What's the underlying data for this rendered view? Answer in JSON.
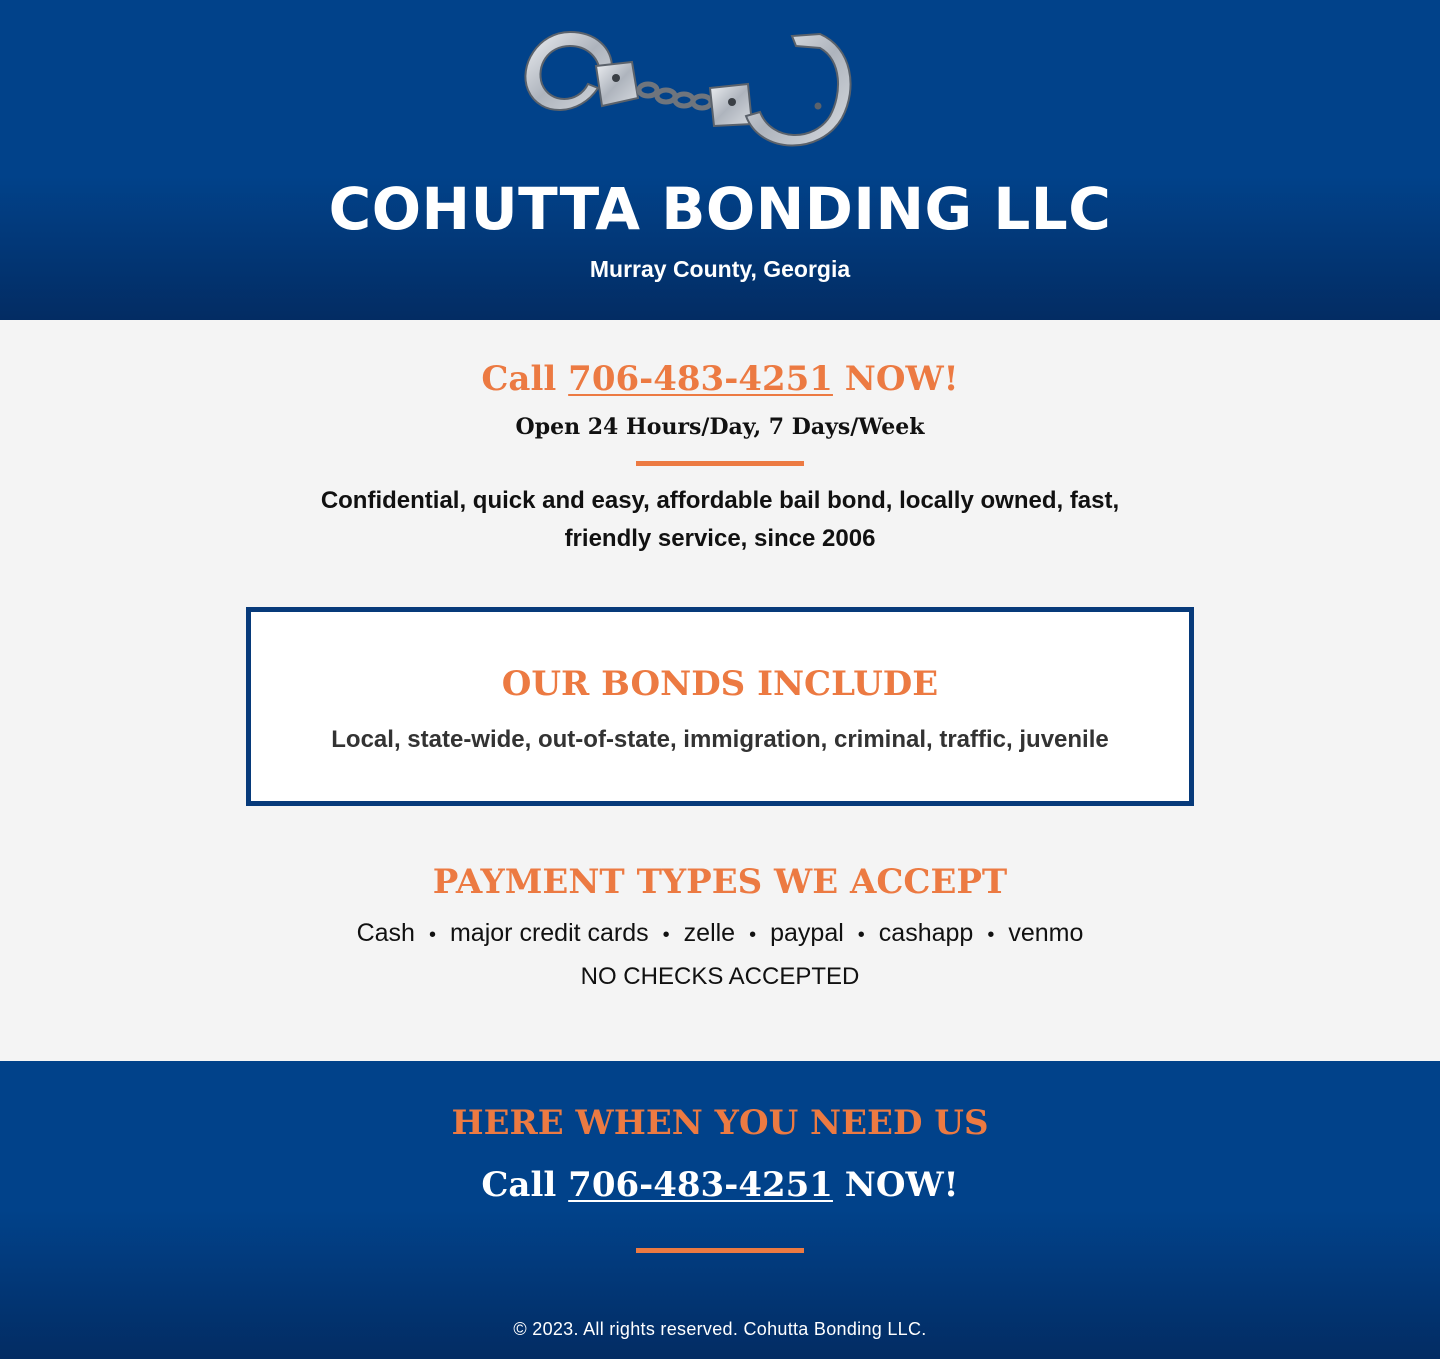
{
  "header": {
    "logo_icon": "handcuffs-icon",
    "title": "COHUTTA BONDING LLC",
    "subtitle": "Murray County, Georgia"
  },
  "main": {
    "call_prefix": "Call",
    "phone": "706-483-4251",
    "call_suffix": "NOW!",
    "hours": "Open 24 Hours/Day, 7 Days/Week",
    "tagline": "Confidential, quick and easy, affordable bail bond, locally owned, fast, friendly service, since 2006"
  },
  "bonds": {
    "title": "OUR BONDS INCLUDE",
    "list": "Local, state-wide, out-of-state, immigration, criminal, traffic, juvenile"
  },
  "payments": {
    "title": "PAYMENT TYPES WE ACCEPT",
    "separator": "•",
    "types": [
      "Cash",
      "major credit cards",
      "zelle",
      "paypal",
      "cashapp",
      "venmo"
    ],
    "note": "NO CHECKS ACCEPTED"
  },
  "footer": {
    "title": "HERE WHEN YOU NEED US",
    "call_prefix": "Call",
    "phone": "706-483-4251",
    "call_suffix": "NOW!",
    "copyright": "© 2023. All rights reserved. Cohutta Bonding LLC."
  },
  "colors": {
    "navy": "#01428a",
    "accent_orange": "#ec7a42",
    "box_border": "#073a7a"
  }
}
